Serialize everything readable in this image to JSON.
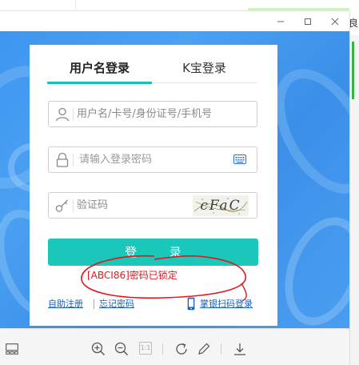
{
  "right_tab": {
    "label": "良"
  },
  "login": {
    "tabs": [
      {
        "label": "用户名登录",
        "active": true
      },
      {
        "label": "K宝登录",
        "active": false
      }
    ],
    "username_placeholder": "用户名/卡号/身份证号/手机号",
    "password_placeholder": "请输入登录密码",
    "captcha_placeholder": "验证码",
    "captcha_text": "cFaC",
    "submit_label": "登 录",
    "error_message": "[ABCI86]密码已锁定",
    "links": {
      "register": "自助注册",
      "forgot": "忘记密码",
      "scan": "掌银扫码登录"
    }
  },
  "colors": {
    "accent": "#1ac7b8",
    "error": "#e3141c",
    "background_blue": "#4a9ef1",
    "link": "#1a5fb4"
  },
  "toolbar": {
    "icons": [
      "sidebar-toggle-icon",
      "zoom-in-icon",
      "zoom-out-icon",
      "actual-size-icon",
      "rotate-icon",
      "edit-icon",
      "download-icon"
    ],
    "ratio_label": "1:1"
  }
}
